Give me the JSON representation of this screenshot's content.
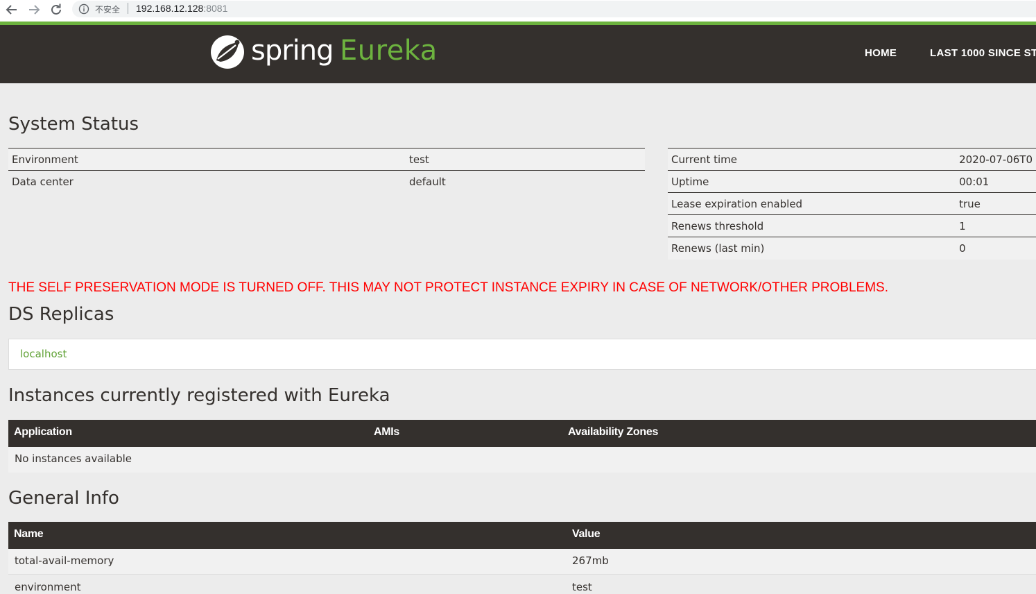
{
  "browser": {
    "insecure_label": "不安全",
    "url_host": "192.168.12.128",
    "url_port": ":8081"
  },
  "header": {
    "logo_spring": "spring",
    "logo_eureka": "Eureka",
    "nav": [
      "HOME",
      "LAST 1000 SINCE ST"
    ]
  },
  "system_status": {
    "title": "System Status",
    "left": [
      {
        "label": "Environment",
        "value": "test"
      },
      {
        "label": "Data center",
        "value": "default"
      }
    ],
    "right": [
      {
        "label": "Current time",
        "value": "2020-07-06T0"
      },
      {
        "label": "Uptime",
        "value": "00:01"
      },
      {
        "label": "Lease expiration enabled",
        "value": "true"
      },
      {
        "label": "Renews threshold",
        "value": "1"
      },
      {
        "label": "Renews (last min)",
        "value": "0"
      }
    ]
  },
  "warning": "THE SELF PRESERVATION MODE IS TURNED OFF. THIS MAY NOT PROTECT INSTANCE EXPIRY IN CASE OF NETWORK/OTHER PROBLEMS.",
  "replicas": {
    "title": "DS Replicas",
    "items": [
      "localhost"
    ]
  },
  "instances": {
    "title": "Instances currently registered with Eureka",
    "columns": [
      "Application",
      "AMIs",
      "Availability Zones"
    ],
    "empty_text": "No instances available"
  },
  "general_info": {
    "title": "General Info",
    "columns": [
      "Name",
      "Value"
    ],
    "rows": [
      {
        "name": "total-avail-memory",
        "value": "267mb"
      },
      {
        "name": "environment",
        "value": "test"
      }
    ]
  },
  "colors": {
    "brand_green": "#6db33f",
    "header_dark": "#34302d",
    "warning_red": "#ff0000"
  }
}
